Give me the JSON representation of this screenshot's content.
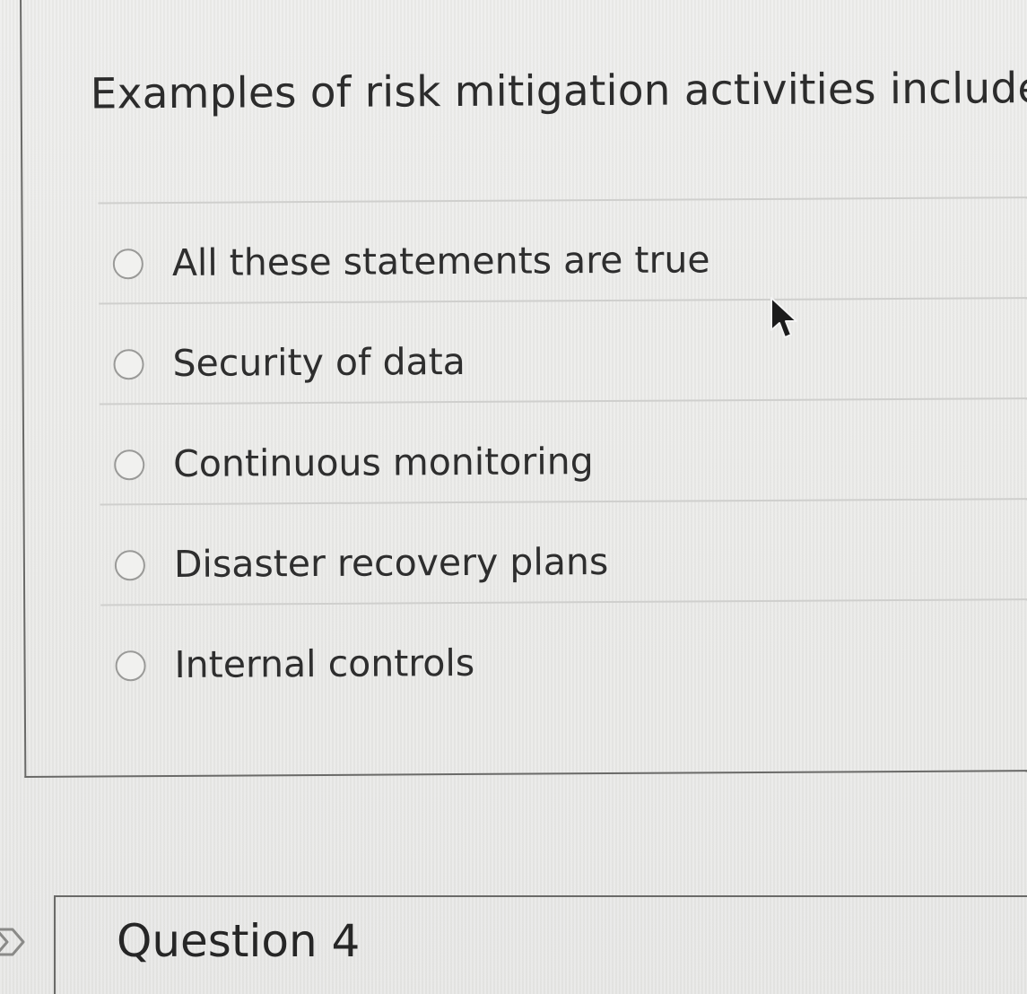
{
  "question": {
    "text": "Examples of risk mitigation activities include:"
  },
  "options": [
    {
      "label": "All these statements are true",
      "selected": false
    },
    {
      "label": "Security of data",
      "selected": false
    },
    {
      "label": "Continuous monitoring",
      "selected": false
    },
    {
      "label": "Disaster recovery plans",
      "selected": false
    },
    {
      "label": "Internal controls",
      "selected": false
    }
  ],
  "next_question": {
    "title": "Question 4"
  },
  "icons": {
    "cursor": "mouse-pointer-icon",
    "nav": "chevron-right-icon",
    "radio": "radio-unselected-icon"
  },
  "colors": {
    "text": "#2c2c2c",
    "border": "#6a6a68",
    "divider": "#cfcfcd",
    "radio_border": "#9a9a98"
  }
}
